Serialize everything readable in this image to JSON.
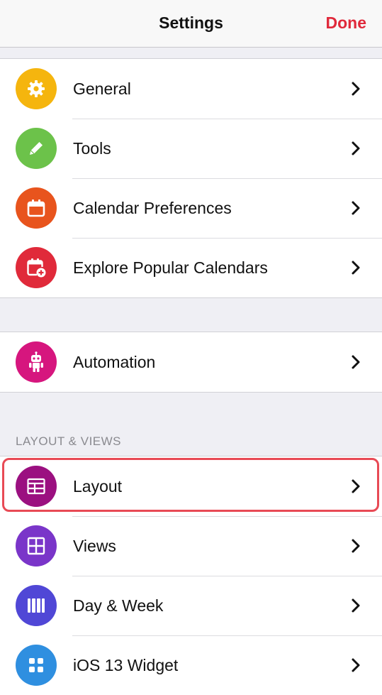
{
  "navbar": {
    "title": "Settings",
    "done_label": "Done"
  },
  "groups": [
    {
      "items": [
        {
          "label": "General",
          "icon": "gear-icon",
          "color": "#f5b50e"
        },
        {
          "label": "Tools",
          "icon": "pencil-icon",
          "color": "#6cc24a"
        },
        {
          "label": "Calendar Preferences",
          "icon": "calendar-icon",
          "color": "#e8541d"
        },
        {
          "label": "Explore Popular Calendars",
          "icon": "calendar-add-icon",
          "color": "#e02a3a"
        }
      ]
    },
    {
      "items": [
        {
          "label": "Automation",
          "icon": "robot-icon",
          "color": "#d6167e"
        }
      ]
    },
    {
      "header": "LAYOUT & VIEWS",
      "items": [
        {
          "label": "Layout",
          "icon": "table-layout-icon",
          "color": "#9b1080"
        },
        {
          "label": "Views",
          "icon": "grid-view-icon",
          "color": "#7a35c9"
        },
        {
          "label": "Day & Week",
          "icon": "columns-icon",
          "color": "#5047d6"
        },
        {
          "label": "iOS 13 Widget",
          "icon": "widget-icon",
          "color": "#2f8fe0"
        }
      ]
    }
  ],
  "highlight_color": "#e84a55"
}
